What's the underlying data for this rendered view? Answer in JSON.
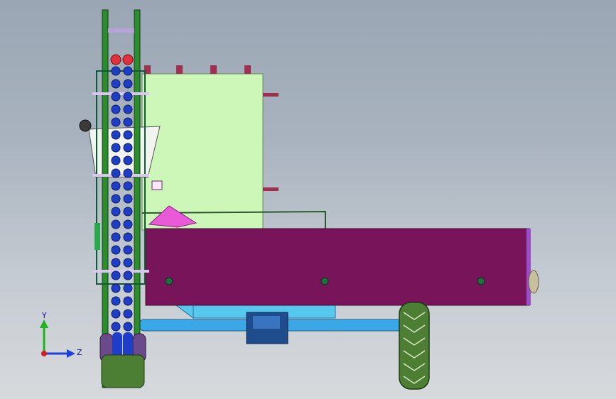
{
  "viewport": {
    "background_top": "#9aa6b4",
    "background_bottom": "#d7dadd"
  },
  "model": {
    "colors": {
      "hopper_panel": "#ccf7b8",
      "conveyor_box": "#78145a",
      "axle": "#3aa7e6",
      "chain_frame": "#2d8c2d",
      "drum": "#1f3ec8",
      "roller_cap": "#e0323c",
      "funnel": "#e85ad8",
      "tire": "#4c7e34",
      "gearbox": "#1f4c8c"
    }
  },
  "triad": {
    "x_label": "Y",
    "z_label": "Z",
    "y_color": "#1fb21f",
    "z_color": "#1f3fd6",
    "origin_color": "#d11f1f"
  }
}
